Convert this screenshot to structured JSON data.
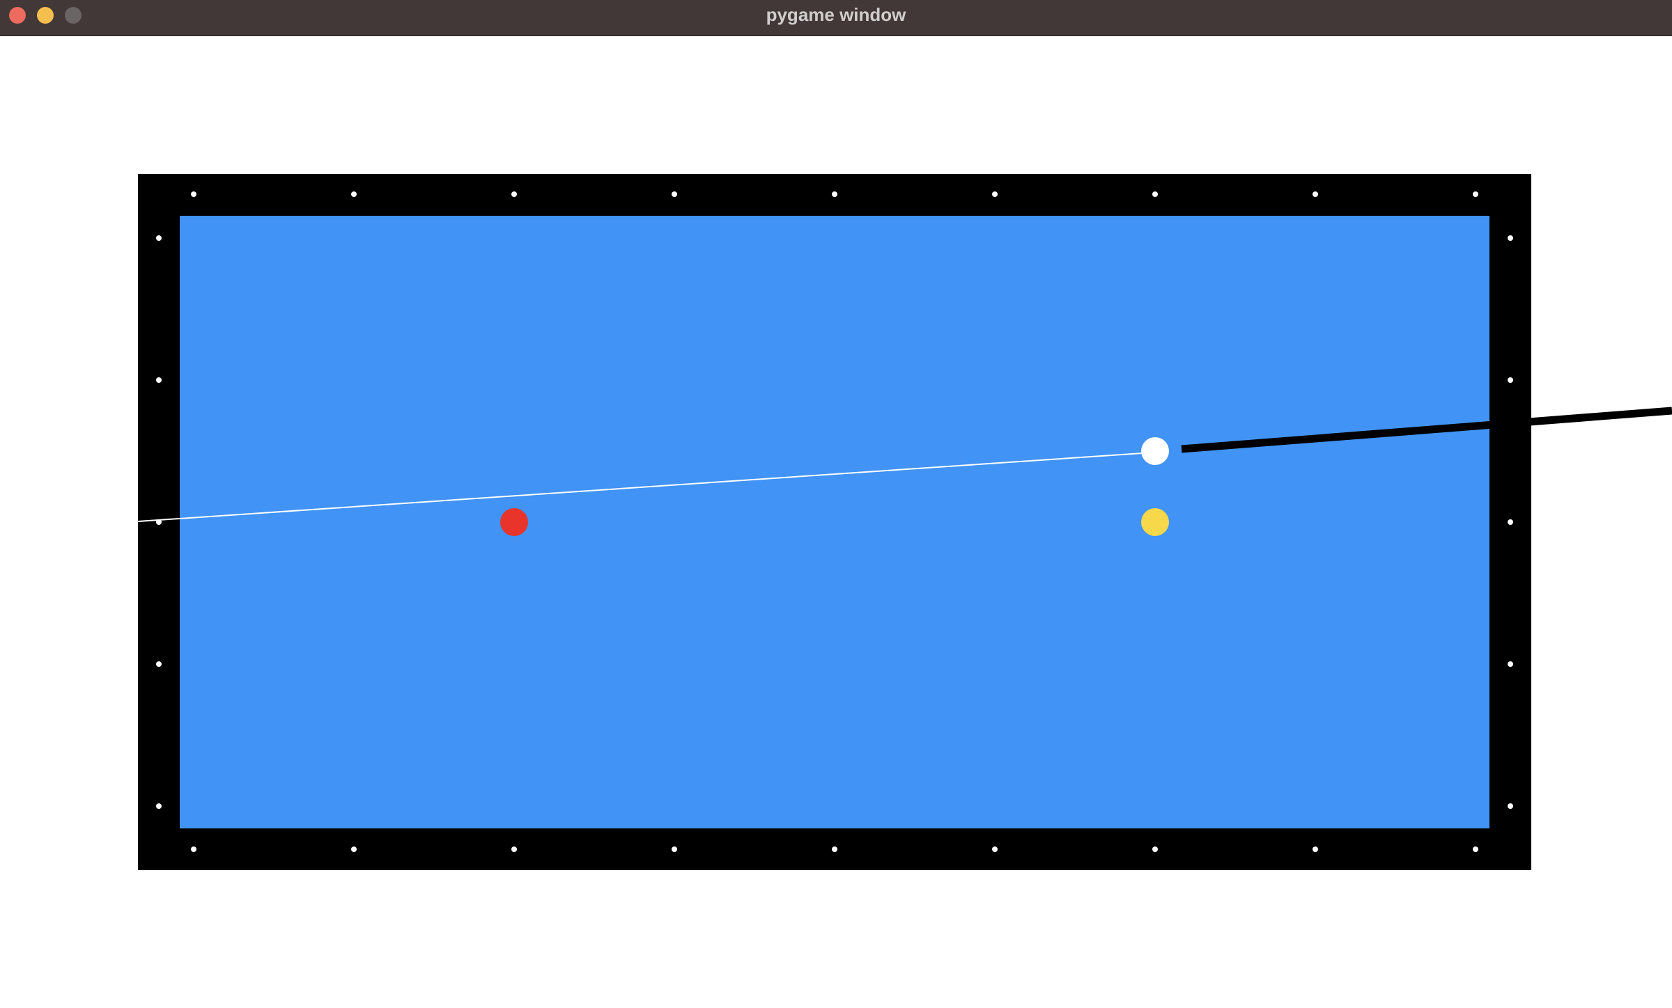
{
  "window": {
    "title": "pygame window"
  },
  "colors": {
    "titlebar": "#433838",
    "rail": "#000000",
    "cloth": "#4193f5",
    "cue_ball": "#ffffff",
    "red_ball": "#e8342a",
    "yellow_ball": "#f6d84a",
    "cue_stick": "#000000",
    "aim_line": "#ffffff",
    "diamond": "#ffffff"
  },
  "table": {
    "rail_color": "#000000",
    "cloth_color": "#4193f5"
  },
  "balls": [
    {
      "name": "cue-ball",
      "color": "#ffffff"
    },
    {
      "name": "red-ball",
      "color": "#e8342a"
    },
    {
      "name": "yellow-ball",
      "color": "#f6d84a"
    }
  ]
}
